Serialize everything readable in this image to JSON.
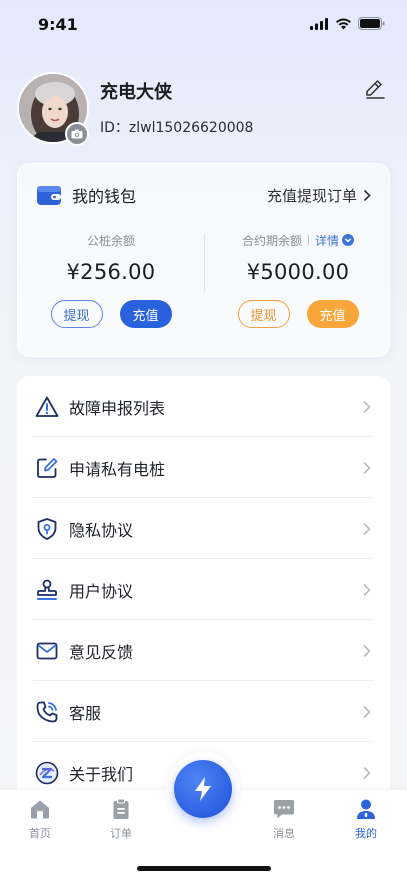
{
  "status_bar": {
    "time": "9:41"
  },
  "profile": {
    "username": "充电大侠",
    "id_text": "ID：zlwl15026620008"
  },
  "wallet": {
    "title": "我的钱包",
    "link": "充值提现订单",
    "public": {
      "label": "公桩余额",
      "amount": "¥256.00",
      "withdraw": "提现",
      "recharge": "充值"
    },
    "contract": {
      "label": "合约期余额",
      "detail": "详情",
      "amount": "¥5000.00",
      "withdraw": "提现",
      "recharge": "充值"
    }
  },
  "menu": {
    "items": [
      {
        "label": "故障申报列表",
        "icon": "warning-icon"
      },
      {
        "label": "申请私有电桩",
        "icon": "edit-icon"
      },
      {
        "label": "隐私协议",
        "icon": "shield-icon"
      },
      {
        "label": "用户协议",
        "icon": "stamp-icon"
      },
      {
        "label": "意见反馈",
        "icon": "mail-icon"
      },
      {
        "label": "客服",
        "icon": "phone-icon"
      },
      {
        "label": "关于我们",
        "icon": "logo-icon"
      }
    ]
  },
  "tabbar": {
    "home": "首页",
    "orders": "订单",
    "messages": "消息",
    "mine": "我的"
  },
  "colors": {
    "primary": "#2a62dd",
    "orange": "#f9a63a"
  }
}
